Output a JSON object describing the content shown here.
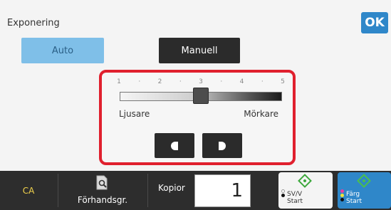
{
  "header": {
    "title": "Exponering",
    "ok_label": "OK",
    "accent_color": "#2f87c9"
  },
  "modes": {
    "auto_label": "Auto",
    "manual_label": "Manuell",
    "selected": "Manuell"
  },
  "exposure": {
    "ticks": [
      "1",
      "2",
      "3",
      "4",
      "5"
    ],
    "value": 3,
    "min": 1,
    "max": 5,
    "left_label": "Ljusare",
    "right_label": "Mörkare",
    "highlight_color": "#e0202e"
  },
  "bottom": {
    "ca_label": "CA",
    "preview_label": "Förhandsgr.",
    "copies_label": "Kopior",
    "copies_value": "1",
    "bw_start_line1": "SV/V",
    "bw_start_line2": "Start",
    "color_start_line1": "Färg",
    "color_start_line2": "Start"
  }
}
